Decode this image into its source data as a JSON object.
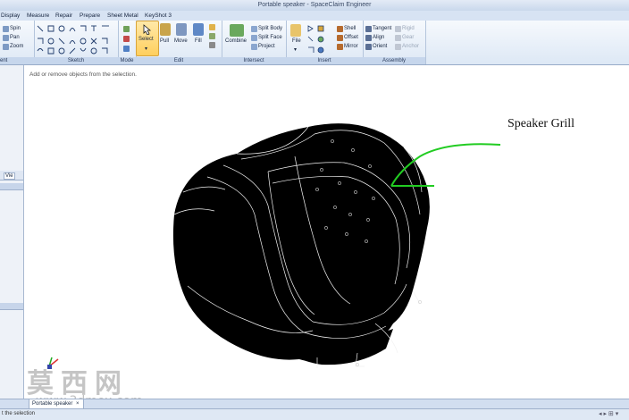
{
  "window": {
    "title": "Portable speaker - SpaceClaim Engineer"
  },
  "tabs": [
    "Display",
    "Measure",
    "Repair",
    "Prepare",
    "Sheet Metal",
    "KeyShot 3"
  ],
  "ribbon": {
    "orient": {
      "items": [
        "Spin",
        "Pan",
        "Zoom"
      ],
      "label": "ent"
    },
    "sketch": {
      "label": "Sketch"
    },
    "mode": {
      "label": "Mode"
    },
    "edit": {
      "items": [
        "Select",
        "Pull",
        "Move",
        "Fill"
      ],
      "label": "Edit"
    },
    "intersect": {
      "combine": "Combine",
      "items": [
        "Split Body",
        "Split Face",
        "Project"
      ],
      "label": "Intersect"
    },
    "insert": {
      "file": "File",
      "items": [
        "Shell",
        "Offset",
        "Mirror"
      ],
      "label": "Insert"
    },
    "assembly": {
      "items": [
        "Tangent",
        "Align",
        "Orient"
      ],
      "dim_items": [
        "Rigid",
        "Gear",
        "Anchor"
      ],
      "label": "Assembly"
    }
  },
  "left_panel": {
    "tab": "Vie"
  },
  "canvas": {
    "hint": "Add or remove objects from the selection.",
    "annotation": "Speaker Grill"
  },
  "document_tab": {
    "label": "Portable speaker",
    "close": "×"
  },
  "status": {
    "text": "t the selection"
  },
  "watermark": {
    "cn": "莫西网",
    "url": "www.3dmox.com"
  },
  "colors": {
    "ribbon": "#dde8f5",
    "annotation_arrow": "#22cc22",
    "model": "#000000"
  }
}
